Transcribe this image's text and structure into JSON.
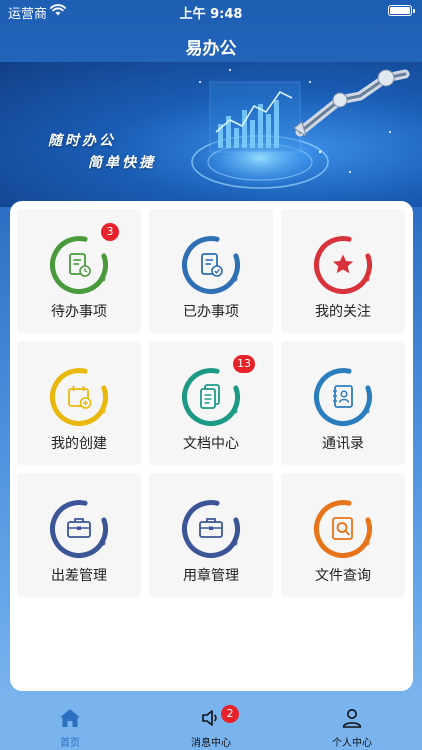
{
  "status_bar": {
    "carrier": "运营商",
    "time": "上午 9:48"
  },
  "nav": {
    "title": "易办公"
  },
  "banner": {
    "line1": "随时办公",
    "line2": "简单快捷"
  },
  "tiles": [
    {
      "label": "待办事项",
      "badge": "3",
      "color": "#4a9a3c",
      "icon": "todo-list-clock-icon"
    },
    {
      "label": "已办事项",
      "badge": "",
      "color": "#2f6fb3",
      "icon": "done-list-check-icon"
    },
    {
      "label": "我的关注",
      "badge": "",
      "color": "#d8333a",
      "icon": "star-icon"
    },
    {
      "label": "我的创建",
      "badge": "",
      "color": "#e8b90c",
      "icon": "calendar-add-icon"
    },
    {
      "label": "文档中心",
      "badge": "13",
      "color": "#1d9a86",
      "icon": "documents-icon"
    },
    {
      "label": "通讯录",
      "badge": "",
      "color": "#2b7ebd",
      "icon": "contact-book-icon"
    },
    {
      "label": "出差管理",
      "badge": "",
      "color": "#3b5597",
      "icon": "briefcase-icon"
    },
    {
      "label": "用章管理",
      "badge": "",
      "color": "#3b5597",
      "icon": "briefcase-icon"
    },
    {
      "label": "文件查询",
      "badge": "",
      "color": "#e8741a",
      "icon": "file-search-icon"
    }
  ],
  "tab_bar": {
    "home": {
      "label": "首页",
      "color": "#2d6fc0"
    },
    "messages": {
      "label": "消息中心",
      "badge": "2"
    },
    "profile": {
      "label": "个人中心"
    }
  }
}
